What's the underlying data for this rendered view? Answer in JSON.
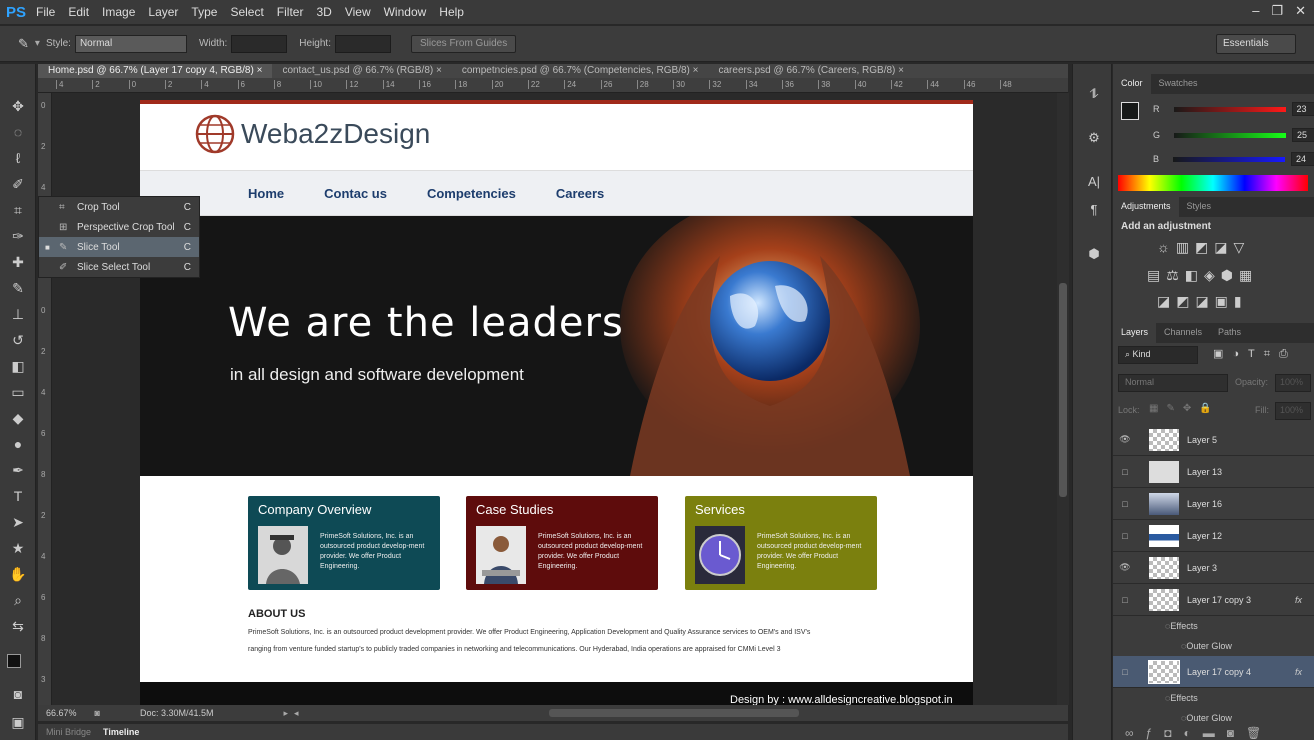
{
  "app": {
    "logo": "PS"
  },
  "menu": [
    "File",
    "Edit",
    "Image",
    "Layer",
    "Type",
    "Select",
    "Filter",
    "3D",
    "View",
    "Window",
    "Help"
  ],
  "window_buttons": {
    "minimize": "–",
    "restore": "❐",
    "close": "✕"
  },
  "options": {
    "style_label": "Style:",
    "style_value": "Normal",
    "width_label": "Width:",
    "height_label": "Height:",
    "slices_button": "Slices From Guides",
    "workspace": "Essentials"
  },
  "tabs": [
    {
      "label": "Home.psd @ 66.7% (Layer 17 copy 4, RGB/8)",
      "close": "×"
    },
    {
      "label": "contact_us.psd @ 66.7% (RGB/8)",
      "close": "×"
    },
    {
      "label": "competncies.psd @ 66.7% (Competencies, RGB/8)",
      "close": "×"
    },
    {
      "label": "careers.psd @ 66.7% (Careers, RGB/8)",
      "close": "×"
    }
  ],
  "ruler_top": [
    "4",
    "2",
    "0",
    "2",
    "4",
    "6",
    "8",
    "10",
    "12",
    "14",
    "16",
    "18",
    "20",
    "22",
    "24",
    "26",
    "28",
    "30",
    "32",
    "34",
    "36",
    "38",
    "40",
    "42",
    "44",
    "46",
    "48"
  ],
  "ruler_left": [
    "0",
    "2",
    "4",
    "6",
    "8",
    "0",
    "2",
    "4",
    "6",
    "8",
    "2",
    "4",
    "6",
    "8",
    "3"
  ],
  "flyout": [
    {
      "label": "Crop Tool",
      "shortcut": "C"
    },
    {
      "label": "Perspective Crop Tool",
      "shortcut": "C"
    },
    {
      "label": "Slice Tool",
      "shortcut": "C"
    },
    {
      "label": "Slice Select Tool",
      "shortcut": "C"
    }
  ],
  "site": {
    "logo_text": "Weba2zDesign",
    "nav": [
      "Home",
      "Contac us",
      "Competencies",
      "Careers"
    ],
    "hero_title": "We are the leaders",
    "hero_sub": "in all design and software development",
    "cards": [
      {
        "title": "Company Overview",
        "text": "PrimeSoft Solutions, Inc. is an outsourced product develop-ment provider. We offer Product Engineering.",
        "color": "#0e4a55"
      },
      {
        "title": "Case Studies",
        "text": "PrimeSoft Solutions, Inc. is an outsourced product develop-ment provider. We offer Product Engineering.",
        "color": "#5e0c0c"
      },
      {
        "title": "Services",
        "text": "PrimeSoft Solutions, Inc. is an outsourced product develop-ment provider. We offer Product Engineering.",
        "color": "#7b800e"
      }
    ],
    "about_title": "ABOUT US",
    "about_line1": "PrimeSoft Solutions, Inc. is an outsourced product development provider. We offer Product Engineering, Application Development and Quality Assurance services to OEM's and ISV's",
    "about_line2": "ranging from venture funded startup's to publicly traded companies in networking and telecommunications. Our Hyderabad, India operations are appraised for CMMi Level 3",
    "footer": "Design by : www.alldesigncreative.blogspot.in"
  },
  "status": {
    "zoom": "66.67%",
    "doc": "Doc: 3.30M/41.5M"
  },
  "bottom_tabs": [
    "Mini Bridge",
    "Timeline"
  ],
  "color_panel": {
    "tabs": [
      "Color",
      "Swatches"
    ],
    "R": "23",
    "G": "25",
    "B": "24",
    "r_label": "R",
    "g_label": "G",
    "b_label": "B"
  },
  "adjust_panel": {
    "tabs": [
      "Adjustments",
      "Styles"
    ],
    "title": "Add an adjustment"
  },
  "layers_panel": {
    "tabs": [
      "Layers",
      "Channels",
      "Paths"
    ],
    "kind": "Kind",
    "blend": "Normal",
    "opacity_label": "Opacity:",
    "opacity": "100%",
    "lock_label": "Lock:",
    "fill_label": "Fill:",
    "fill": "100%",
    "layers": [
      {
        "name": "Layer 5",
        "visible": true
      },
      {
        "name": "Layer 13",
        "visible": false
      },
      {
        "name": "Layer 16",
        "visible": false
      },
      {
        "name": "Layer 12",
        "visible": false
      },
      {
        "name": "Layer 3",
        "visible": true
      },
      {
        "name": "Layer 17 copy 3",
        "visible": false,
        "fx": "fx"
      },
      {
        "name": "Layer 17 copy 4",
        "visible": false,
        "fx": "fx",
        "selected": true
      }
    ],
    "effects_label": "Effects",
    "outer_glow_label": "Outer Glow"
  }
}
